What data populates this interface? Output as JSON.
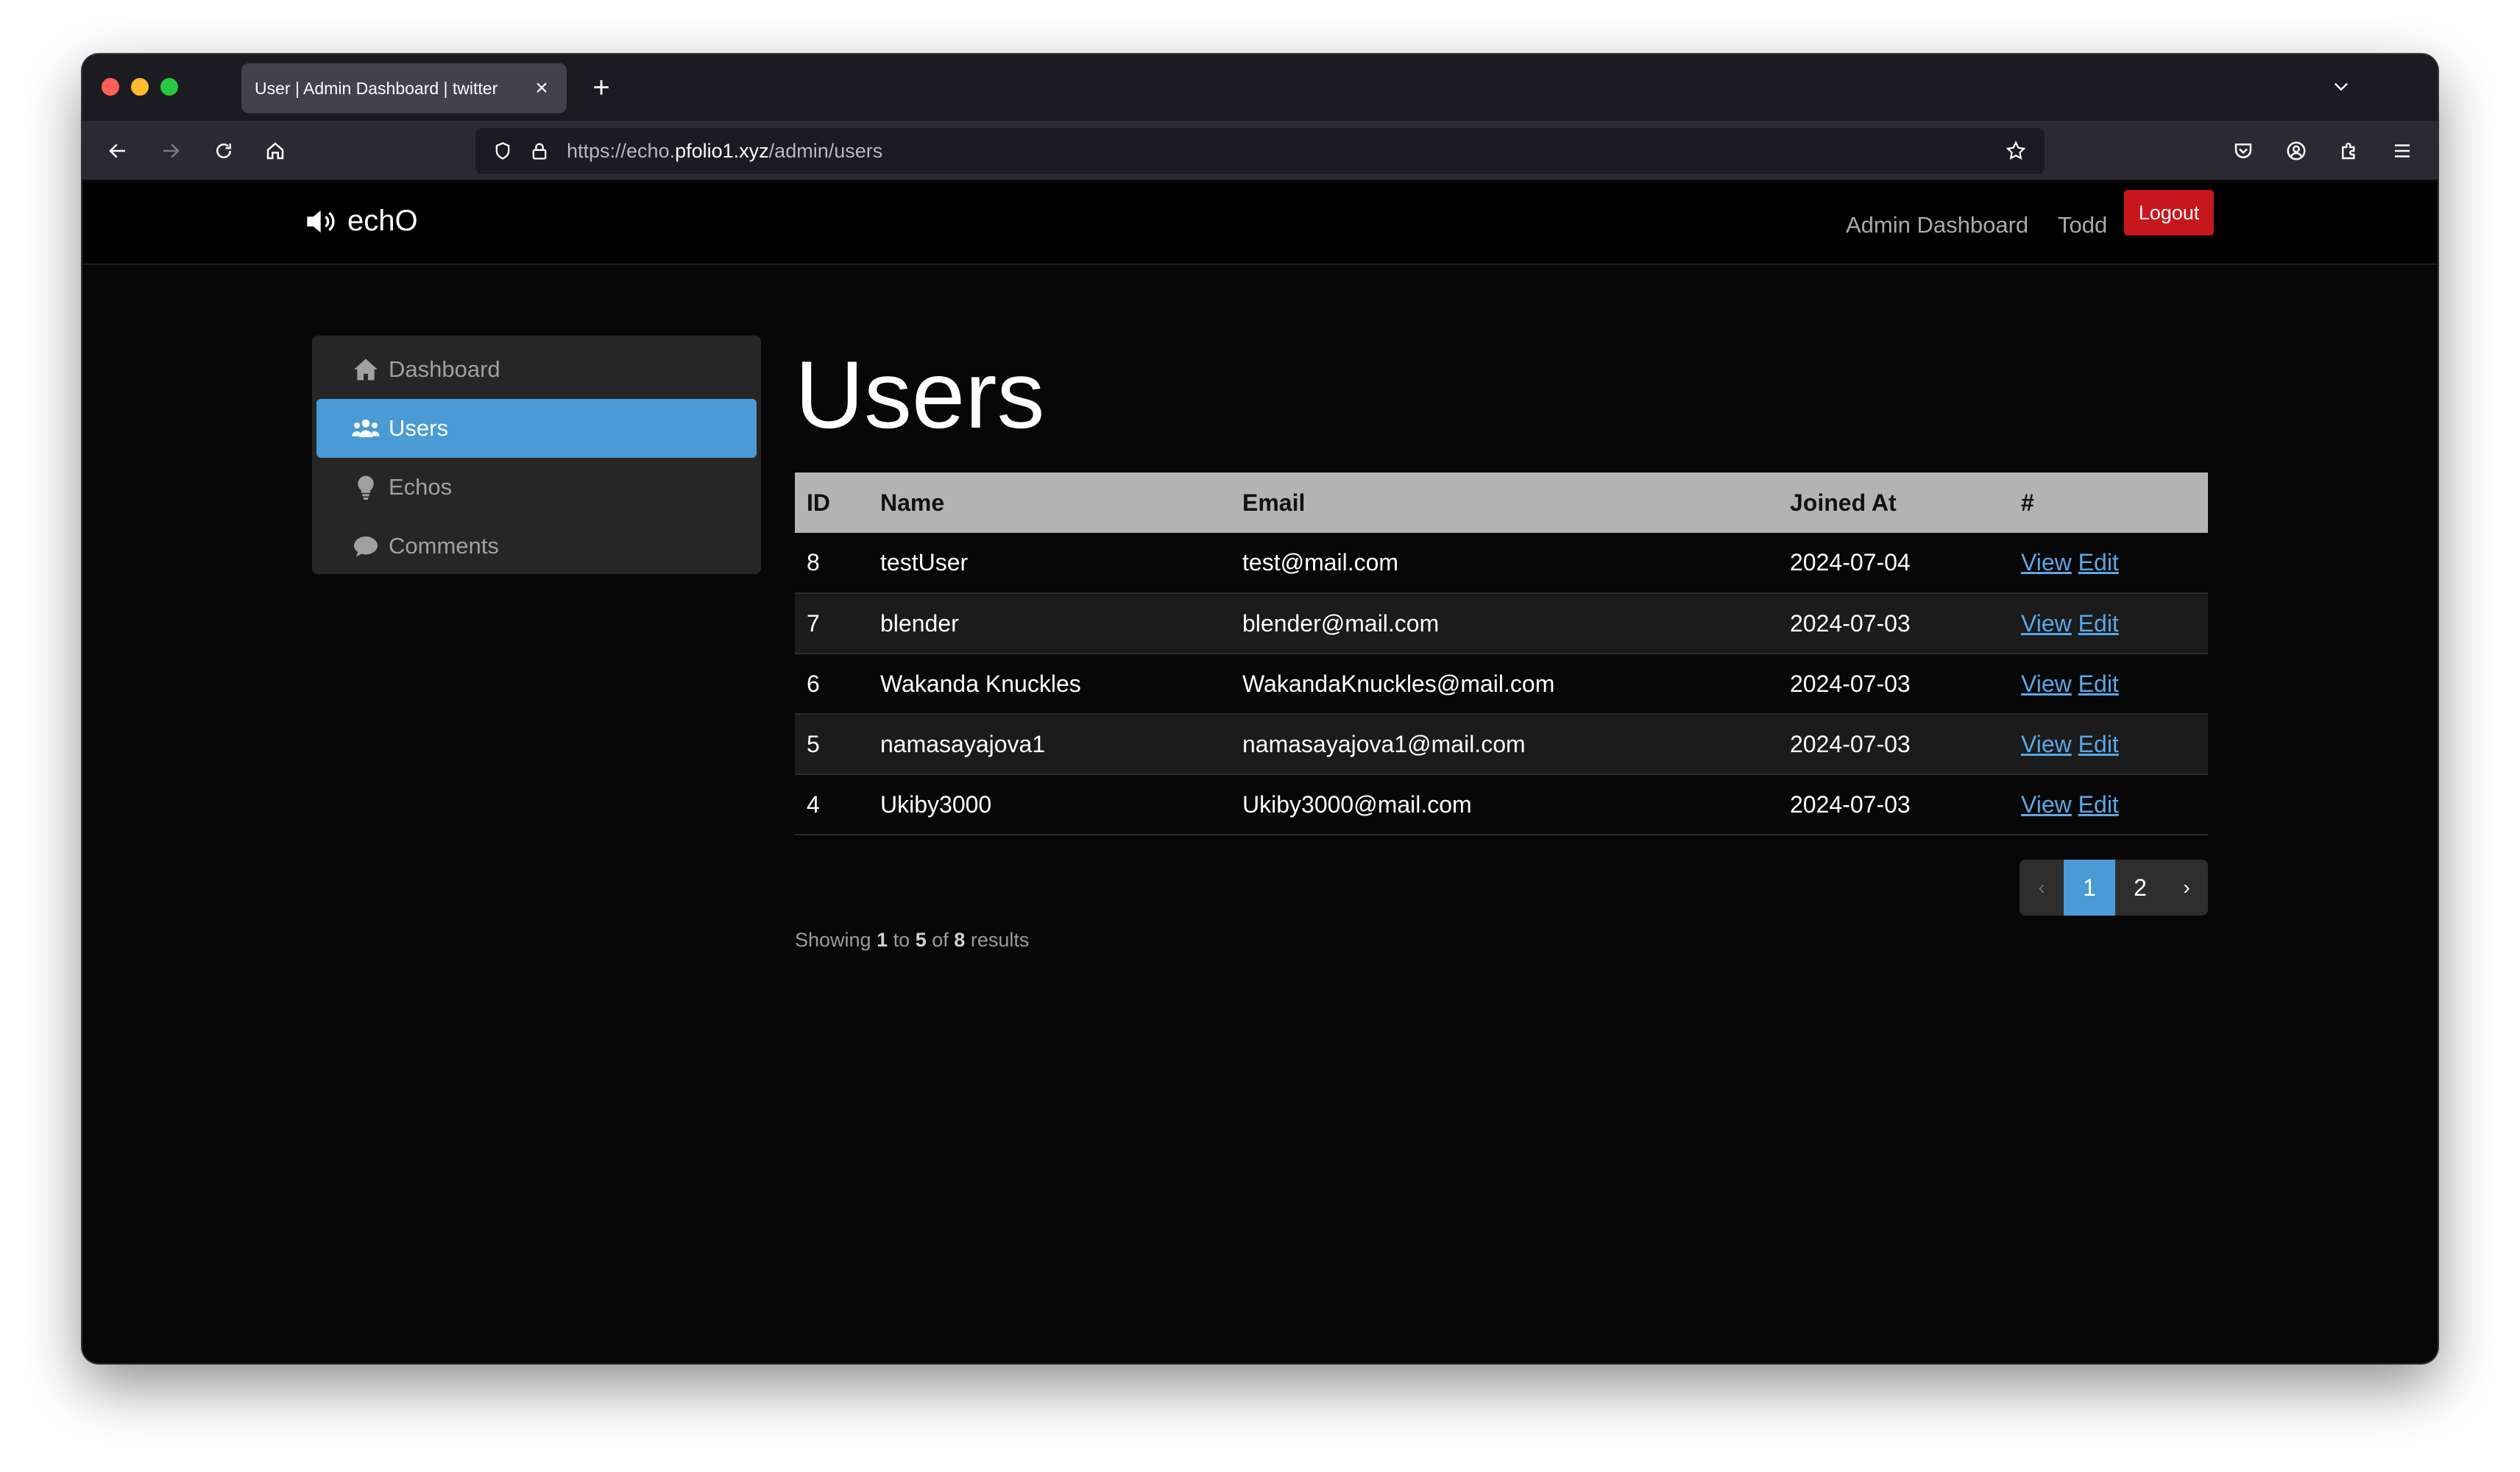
{
  "browser": {
    "tab_title": "User | Admin Dashboard | twitter",
    "url_prefix": "https://echo.",
    "url_domain": "pfolio1.xyz",
    "url_path": "/admin/users"
  },
  "site": {
    "brand": "echO",
    "nav": {
      "admin_dashboard": "Admin Dashboard",
      "user_name": "Todd",
      "logout": "Logout"
    }
  },
  "sidebar": {
    "items": [
      {
        "label": "Dashboard",
        "icon": "home-icon",
        "active": false
      },
      {
        "label": "Users",
        "icon": "users-icon",
        "active": true
      },
      {
        "label": "Echos",
        "icon": "lightbulb-icon",
        "active": false
      },
      {
        "label": "Comments",
        "icon": "comment-icon",
        "active": false
      }
    ]
  },
  "main": {
    "title": "Users",
    "table": {
      "columns": [
        "ID",
        "Name",
        "Email",
        "Joined At",
        "#"
      ],
      "rows": [
        {
          "id": "8",
          "name": "testUser",
          "email": "test@mail.com",
          "joined": "2024-07-04",
          "view": "View",
          "edit": "Edit"
        },
        {
          "id": "7",
          "name": "blender",
          "email": "blender@mail.com",
          "joined": "2024-07-03",
          "view": "View",
          "edit": "Edit"
        },
        {
          "id": "6",
          "name": "Wakanda Knuckles",
          "email": "WakandaKnuckles@mail.com",
          "joined": "2024-07-03",
          "view": "View",
          "edit": "Edit"
        },
        {
          "id": "5",
          "name": "namasayajova1",
          "email": "namasayajova1@mail.com",
          "joined": "2024-07-03",
          "view": "View",
          "edit": "Edit"
        },
        {
          "id": "4",
          "name": "Ukiby3000",
          "email": "Ukiby3000@mail.com",
          "joined": "2024-07-03",
          "view": "View",
          "edit": "Edit"
        }
      ]
    },
    "summary": {
      "showing": "Showing",
      "from": "1",
      "to_word": "to",
      "to": "5",
      "of_word": "of",
      "total": "8",
      "results": "results"
    },
    "pagination": {
      "prev": "‹",
      "pages": [
        "1",
        "2"
      ],
      "current": "1",
      "next": "›"
    }
  },
  "colors": {
    "accent": "#4a9bd5",
    "logout": "#c8161d",
    "link": "#5aa7e6"
  }
}
